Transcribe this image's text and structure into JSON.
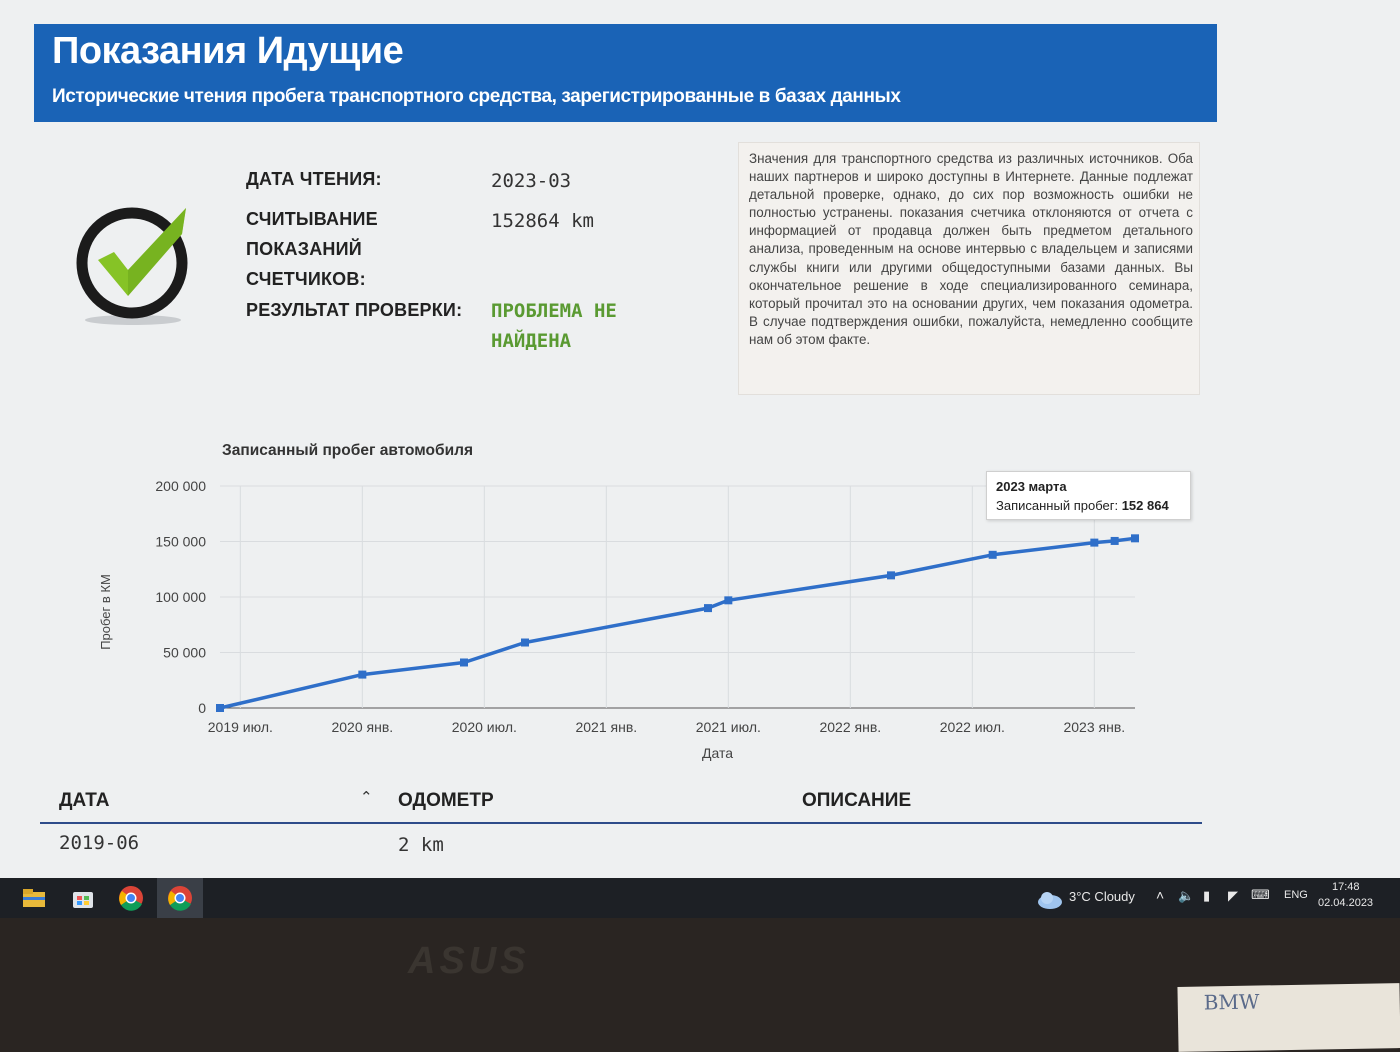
{
  "header": {
    "title": "Показания Идущие",
    "subtitle": "Исторические чтения пробега транспортного средства, зарегистрированные в базах данных"
  },
  "summary": {
    "date_label": "ДАТА ЧТЕНИЯ:",
    "date_value": "2023-03",
    "reading_label_1": "СЧИТЫВАНИЕ",
    "reading_label_2": "ПОКАЗАНИЙ",
    "reading_label_3": "СЧЕТЧИКОВ:",
    "reading_value": "152864 km",
    "result_label": "РЕЗУЛЬТАТ ПРОВЕРКИ:",
    "result_value": "ПРОБЛЕМА НЕ НАЙДЕНА",
    "result_color": "#5a9a32",
    "icon": "check-icon"
  },
  "note": "Значения для транспортного средства из различных источников. Оба наших партнеров и широко доступны в Интернете. Данные подлежат детальной проверке, однако, до сих пор возможность ошибки не полностью устранены. показания счетчика отклоняются от отчета с информацией от продавца должен быть предметом детального анализа, проведенным на основе интервью с владельцем и записями службы книги или другими общедоступными базами данных. Вы окончательное решение в ходе специализированного семинара, который прочитал это на основании других, чем показания одометра. В случае подтверждения ошибки, пожалуйста, немедленно сообщите нам об этом факте.",
  "chart_title": "Записанный пробег автомобиля",
  "tooltip": {
    "date": "2023 марта",
    "label": "Записанный пробег:",
    "value": "152 864"
  },
  "chart_data": {
    "type": "line",
    "title": "Записанный пробег автомобиля",
    "xlabel": "Дата",
    "ylabel": "Пробег в КМ",
    "ylim": [
      0,
      200000
    ],
    "yticks": [
      "0",
      "50 000",
      "100 000",
      "150 000",
      "200 000"
    ],
    "ytick_values": [
      0,
      50000,
      100000,
      150000,
      200000
    ],
    "xticks": [
      "2019 июл.",
      "2020 янв.",
      "2020 июл.",
      "2021 янв.",
      "2021 июл.",
      "2022 янв.",
      "2022 июл.",
      "2023 янв."
    ],
    "xtick_dates": [
      "2019-07",
      "2020-01",
      "2020-07",
      "2021-01",
      "2021-07",
      "2022-01",
      "2022-07",
      "2023-01"
    ],
    "xlim": [
      "2019-06",
      "2023-03"
    ],
    "grid": true,
    "line_color": "#2f6fc9",
    "series": [
      {
        "x": [
          "2019-06",
          "2020-01",
          "2020-06",
          "2020-09",
          "2021-06",
          "2021-07",
          "2022-03",
          "2022-08",
          "2023-01",
          "2023-02",
          "2023-03"
        ],
        "values": [
          2,
          30100,
          41000,
          59000,
          90000,
          97000,
          119500,
          138000,
          149000,
          150500,
          152864
        ]
      }
    ]
  },
  "table": {
    "col_date": "ДАТА",
    "col_odometer": "ОДОМЕТР",
    "col_description": "ОПИСАНИЕ",
    "rows": [
      {
        "date": "2019-06",
        "odometer": "2 km"
      }
    ]
  },
  "taskbar": {
    "weather": "3°C  Cloudy",
    "lang": "ENG",
    "time": "17:48",
    "date": "02.04.2023"
  },
  "monitor_brand": "ASUS",
  "paper_note": "BMW"
}
